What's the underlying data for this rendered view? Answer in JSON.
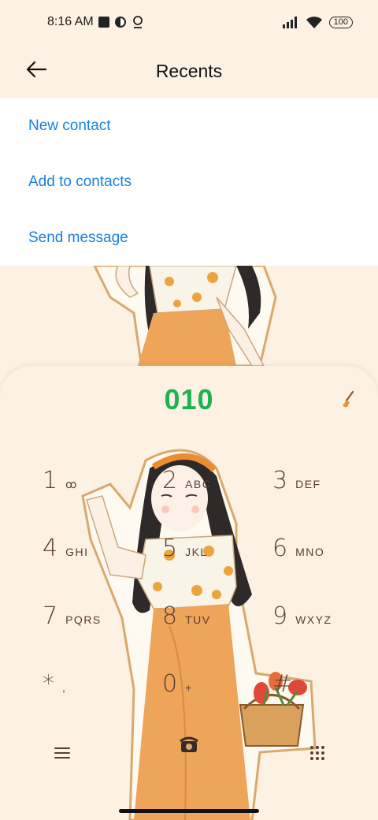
{
  "status_bar": {
    "time": "8:16 AM",
    "battery": "100",
    "icons": [
      "square-notification-icon",
      "data-saver-icon",
      "location-icon",
      "signal-icon",
      "wifi-icon",
      "battery-icon"
    ]
  },
  "header": {
    "title": "Recents",
    "back_icon": "arrow-left-icon"
  },
  "menu": {
    "items": [
      {
        "label": "New contact"
      },
      {
        "label": "Add to contacts"
      },
      {
        "label": "Send message"
      }
    ]
  },
  "dialer": {
    "number": "010",
    "keys": [
      {
        "digit": "1",
        "letters": "ꝏ"
      },
      {
        "digit": "2",
        "letters": "ABC"
      },
      {
        "digit": "3",
        "letters": "DEF"
      },
      {
        "digit": "4",
        "letters": "GHI"
      },
      {
        "digit": "5",
        "letters": "JKL"
      },
      {
        "digit": "6",
        "letters": "MNO"
      },
      {
        "digit": "7",
        "letters": "PQRS"
      },
      {
        "digit": "8",
        "letters": "TUV"
      },
      {
        "digit": "9",
        "letters": "WXYZ"
      },
      {
        "digit": "*",
        "letters": ","
      },
      {
        "digit": "0",
        "letters": "+"
      },
      {
        "digit": "#",
        "letters": ""
      }
    ]
  },
  "colors": {
    "background": "#fcf1e2",
    "accent_blue": "#1a7fe0",
    "number_green": "#1fb255",
    "key_brown": "#5a3e36"
  }
}
